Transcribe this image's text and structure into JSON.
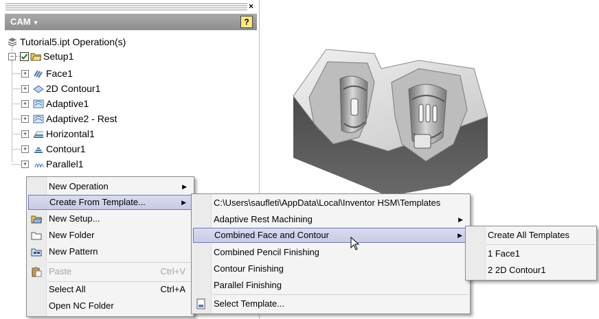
{
  "panel": {
    "title": "CAM",
    "help_label": "?",
    "close_label": "×",
    "root_label": "Tutorial5.ipt Operation(s)",
    "setup_label": "Setup1",
    "operations": [
      {
        "label": "Face1",
        "icon": "face-op-icon"
      },
      {
        "label": "2D Contour1",
        "icon": "contour2d-op-icon"
      },
      {
        "label": "Adaptive1",
        "icon": "adaptive-op-icon"
      },
      {
        "label": "Adaptive2 - Rest",
        "icon": "adaptive-op-icon"
      },
      {
        "label": "Horizontal1",
        "icon": "horizontal-op-icon"
      },
      {
        "label": "Contour1",
        "icon": "contour-op-icon"
      },
      {
        "label": "Parallel1",
        "icon": "parallel-op-icon"
      }
    ]
  },
  "context_menu": {
    "items": [
      {
        "label": "New Operation",
        "has_submenu": true
      },
      {
        "label": "Create From Template...",
        "has_submenu": true,
        "highlighted": true
      },
      {
        "label": "New Setup...",
        "icon": "new-setup-icon"
      },
      {
        "label": "New Folder",
        "icon": "folder-icon"
      },
      {
        "label": "New Pattern",
        "icon": "pattern-icon"
      },
      {
        "label": "Paste",
        "shortcut": "Ctrl+V",
        "disabled": true,
        "icon": "paste-icon"
      },
      {
        "label": "Select All",
        "shortcut": "Ctrl+A"
      },
      {
        "label": "Open NC Folder"
      }
    ]
  },
  "template_menu": {
    "items": [
      {
        "label": "C:\\Users\\saufleti\\AppData\\Local\\Inventor HSM\\Templates"
      },
      {
        "label": "Adaptive Rest Machining",
        "has_submenu": true
      },
      {
        "label": "Combined Face and Contour",
        "has_submenu": true,
        "highlighted": true
      },
      {
        "label": "Combined Pencil Finishing"
      },
      {
        "label": "Contour Finishing"
      },
      {
        "label": "Parallel Finishing"
      },
      {
        "label": "Select Template...",
        "icon": "select-template-icon"
      }
    ]
  },
  "create_menu": {
    "items": [
      {
        "label": "Create All Templates"
      },
      {
        "label": "1 Face1"
      },
      {
        "label": "2 2D Contour1"
      }
    ]
  },
  "colors": {
    "cam_bar": "#9b9b9b",
    "highlight_border": "#6f77b8",
    "highlight_fill": "#cfd3ea"
  }
}
